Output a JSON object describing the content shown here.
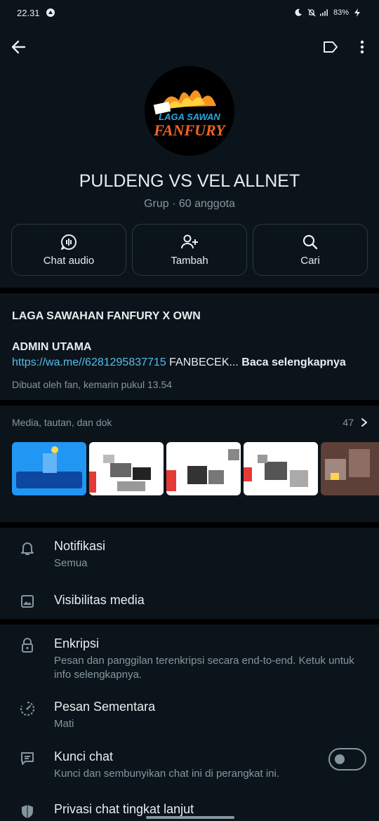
{
  "status": {
    "time": "22.31",
    "battery": "83%"
  },
  "group": {
    "name": "PULDENG VS VEL ALLNET",
    "subtitle": "Grup · 60 anggota",
    "avatar_text": "LAGA SAWAN FANFURY"
  },
  "actions": [
    {
      "label": "Chat audio",
      "icon": "audio-chat-icon"
    },
    {
      "label": "Tambah",
      "icon": "add-person-icon"
    },
    {
      "label": "Cari",
      "icon": "search-icon"
    }
  ],
  "description": {
    "title": "LAGA SAWAHAN FANFURY X OWN",
    "admin": "ADMIN UTAMA",
    "link": "https://wa.me//6281295837715",
    "text": " FANBECEK...",
    "read_more": " Baca selengkapnya",
    "created": "Dibuat oleh fan, kemarin pukul 13.54"
  },
  "media": {
    "title": "Media, tautan, dan dok",
    "count": "47"
  },
  "settings": [
    {
      "title": "Notifikasi",
      "subtitle": "Semua",
      "icon": "bell-icon"
    },
    {
      "title": "Visibilitas media",
      "subtitle": "",
      "icon": "image-icon"
    },
    {
      "title": "Enkripsi",
      "subtitle": "Pesan dan panggilan terenkripsi secara end-to-end. Ketuk untuk info selengkapnya.",
      "icon": "lock-icon"
    },
    {
      "title": "Pesan Sementara",
      "subtitle": "Mati",
      "icon": "timer-icon"
    },
    {
      "title": "Kunci chat",
      "subtitle": "Kunci dan sembunyikan chat ini di perangkat ini.",
      "icon": "chat-lock-icon",
      "toggle": false
    },
    {
      "title": "Privasi chat tingkat lanjut",
      "subtitle": "",
      "icon": "shield-icon"
    }
  ],
  "colors": {
    "background": "#0b141a",
    "link": "#53bdeb",
    "muted": "#8696a0",
    "border": "#2a3942"
  }
}
